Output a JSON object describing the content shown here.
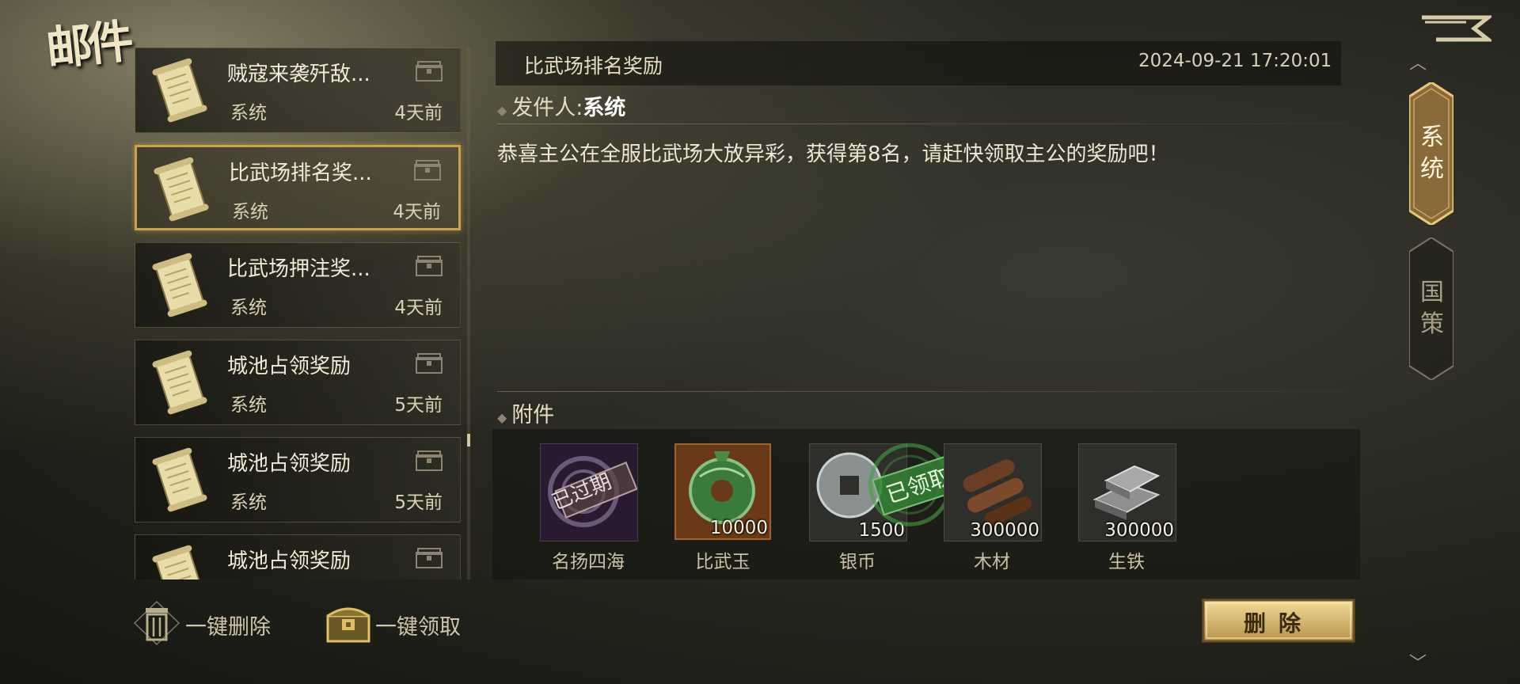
{
  "header": {
    "title": "邮件"
  },
  "mail_list": [
    {
      "title": "贼寇来袭歼敌...",
      "sender": "系统",
      "time": "4天前",
      "selected": false
    },
    {
      "title": "比武场排名奖...",
      "sender": "系统",
      "time": "4天前",
      "selected": true
    },
    {
      "title": "比武场押注奖...",
      "sender": "系统",
      "time": "4天前",
      "selected": false
    },
    {
      "title": "城池占领奖励",
      "sender": "系统",
      "time": "5天前",
      "selected": false
    },
    {
      "title": "城池占领奖励",
      "sender": "系统",
      "time": "5天前",
      "selected": false
    },
    {
      "title": "城池占领奖励",
      "sender": "",
      "time": "",
      "selected": false
    }
  ],
  "bottom_actions": {
    "delete_all": "一键删除",
    "claim_all": "一键领取"
  },
  "detail": {
    "subject": "比武场排名奖励",
    "date": "2024-09-21 17:20:01",
    "sender_label": "发件人:",
    "sender": "系统",
    "body": "恭喜主公在全服比武场大放异彩，获得第8名，请赶快领取主公的奖励吧！",
    "attachments_label": "附件"
  },
  "attachments": [
    {
      "name": "名扬四海",
      "qty": "",
      "stamp": "已过期",
      "icon": "seal-badge-icon"
    },
    {
      "name": "比武玉",
      "qty": "10000",
      "stamp": "",
      "icon": "jade-disc-icon"
    },
    {
      "name": "银币",
      "qty": "1500",
      "stamp": "已领取",
      "icon": "silver-coin-icon"
    },
    {
      "name": "木材",
      "qty": "300000",
      "stamp": "",
      "icon": "wood-logs-icon"
    },
    {
      "name": "生铁",
      "qty": "300000",
      "stamp": "",
      "icon": "iron-ingot-icon"
    }
  ],
  "tabs": [
    {
      "label": "系统",
      "active": true
    },
    {
      "label": "国策",
      "active": false
    }
  ],
  "delete_button": "删除",
  "colors": {
    "gold_accent": "#c9a34b",
    "claimed_stamp": "#3b8a3a",
    "expired_stamp": "#8a4a4a"
  }
}
